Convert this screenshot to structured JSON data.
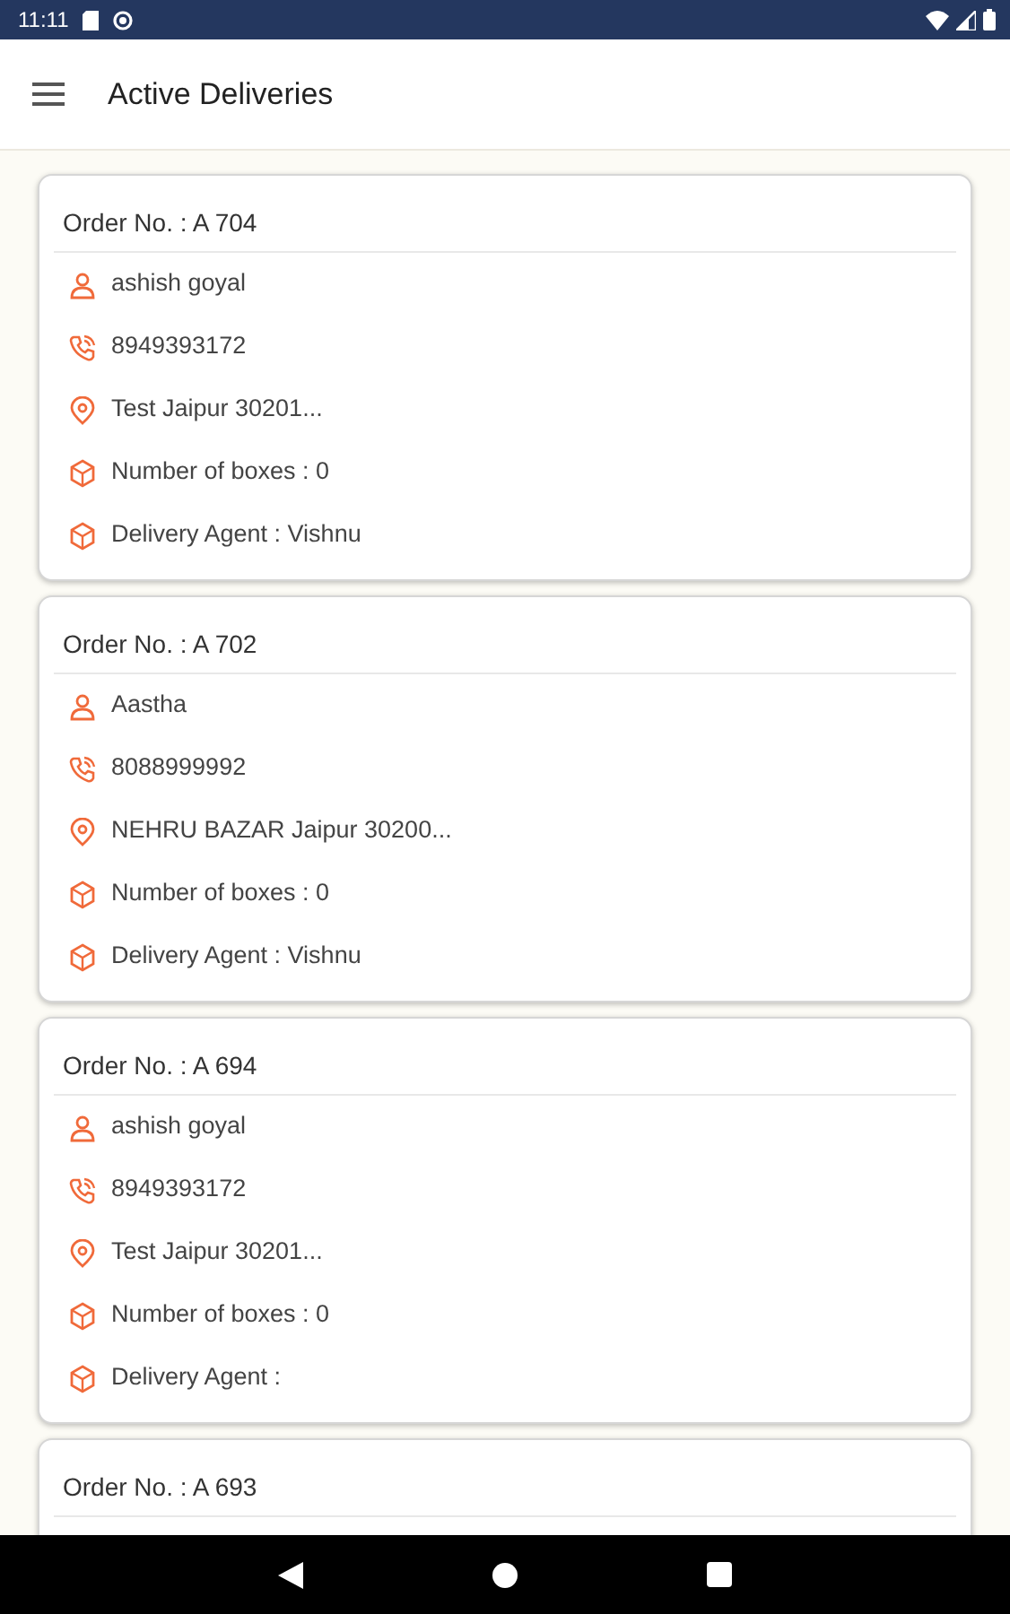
{
  "status_bar": {
    "time": "11:11"
  },
  "app_bar": {
    "title": "Active Deliveries"
  },
  "orders": [
    {
      "order_no": "Order No. : A 704",
      "rows": [
        {
          "kind": "person",
          "text": "ashish goyal"
        },
        {
          "kind": "phone",
          "text": "8949393172"
        },
        {
          "kind": "location",
          "text": "Test Jaipur 30201..."
        },
        {
          "kind": "box",
          "text": "Number of boxes : 0"
        },
        {
          "kind": "box",
          "text": "Delivery Agent : Vishnu"
        }
      ]
    },
    {
      "order_no": "Order No. : A 702",
      "rows": [
        {
          "kind": "person",
          "text": "Aastha"
        },
        {
          "kind": "phone",
          "text": "8088999992"
        },
        {
          "kind": "location",
          "text": "NEHRU BAZAR Jaipur 30200..."
        },
        {
          "kind": "box",
          "text": "Number of boxes : 0"
        },
        {
          "kind": "box",
          "text": "Delivery Agent : Vishnu"
        }
      ]
    },
    {
      "order_no": "Order No. : A 694",
      "rows": [
        {
          "kind": "person",
          "text": "ashish goyal"
        },
        {
          "kind": "phone",
          "text": "8949393172"
        },
        {
          "kind": "location",
          "text": "Test Jaipur 30201..."
        },
        {
          "kind": "box",
          "text": "Number of boxes : 0"
        },
        {
          "kind": "box",
          "text": "Delivery Agent :"
        }
      ]
    },
    {
      "order_no": "Order No. : A 693"
    }
  ]
}
